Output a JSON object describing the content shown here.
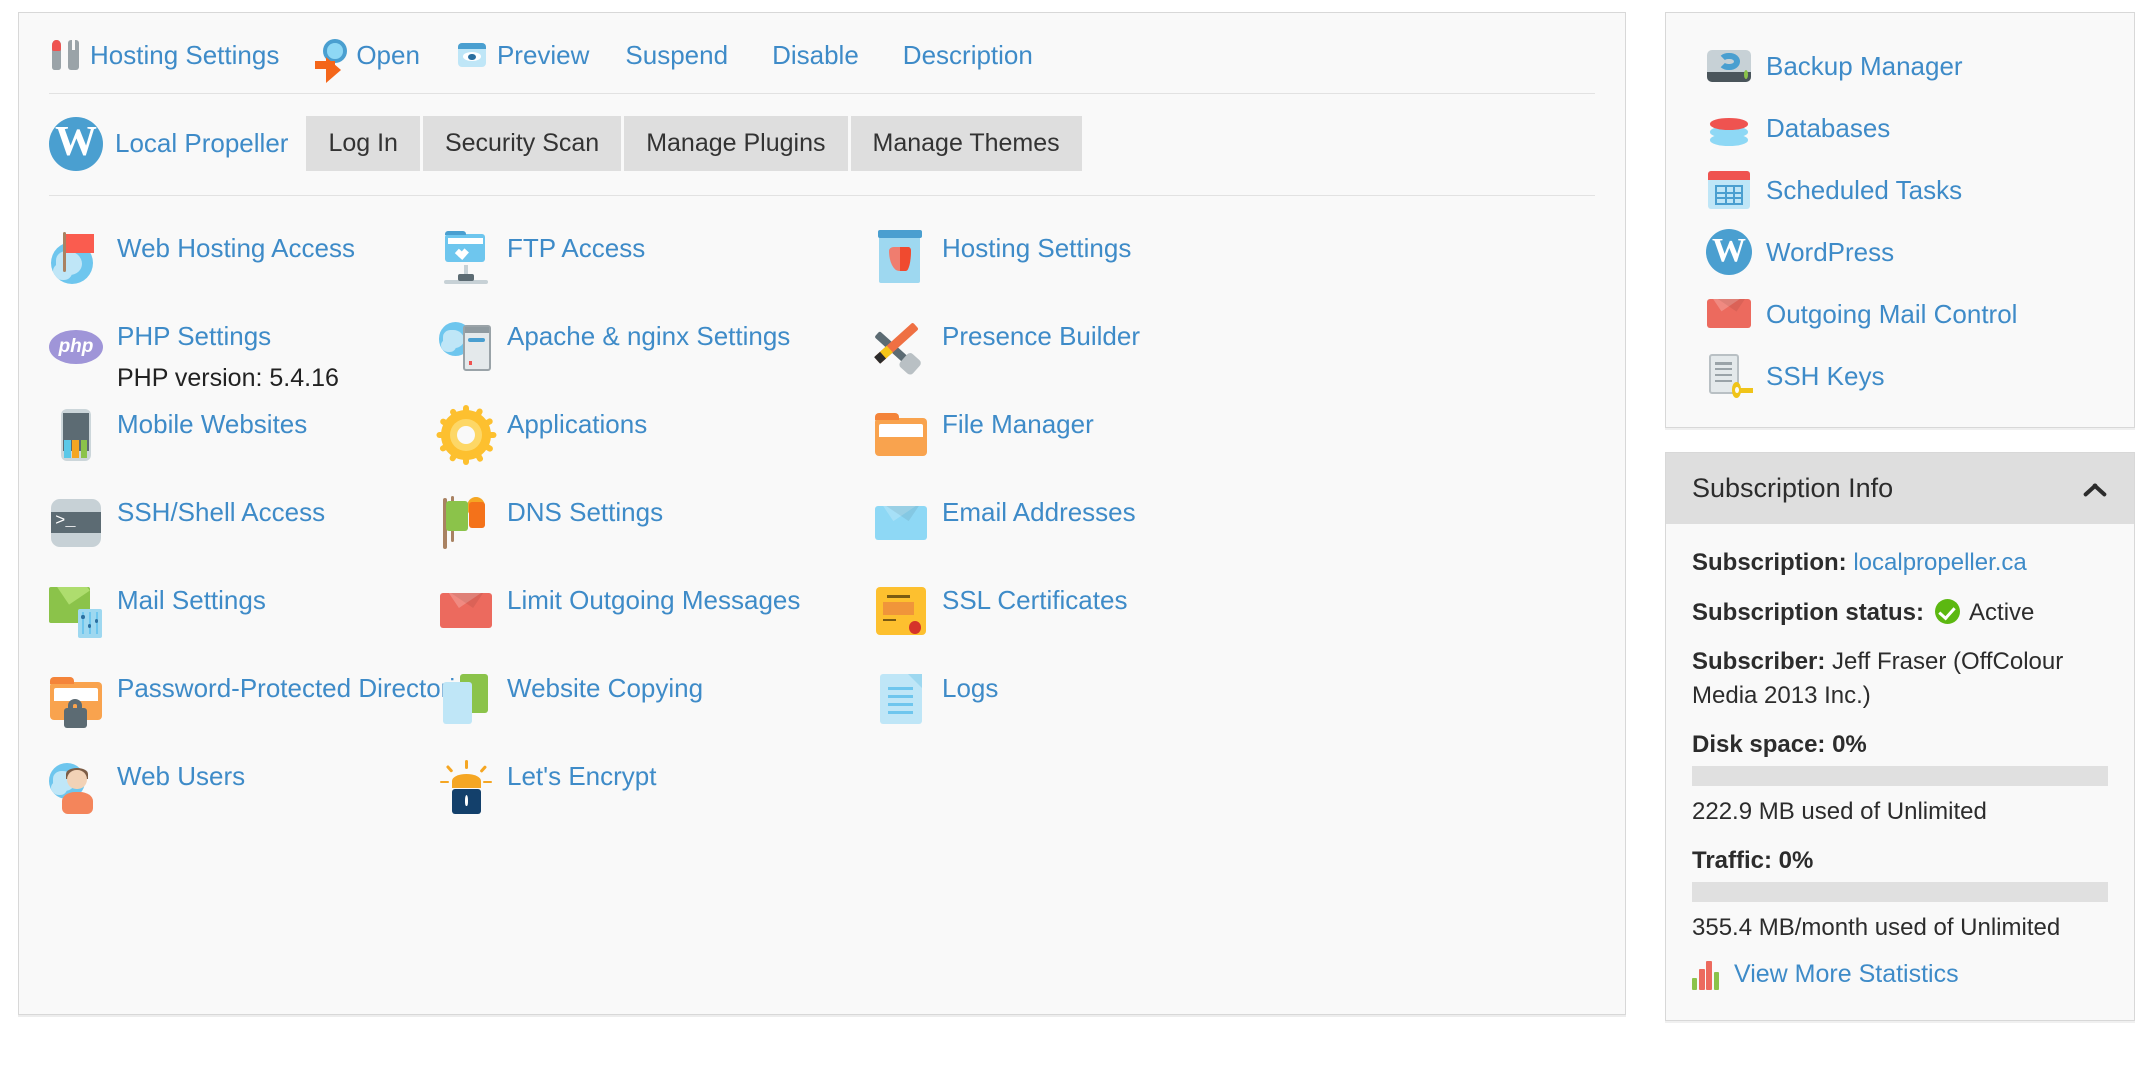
{
  "toolbar": {
    "items": [
      {
        "label": "Hosting Settings",
        "icon": "tools-icon",
        "has_icon": true
      },
      {
        "label": "Open",
        "icon": "open-globe-arrow-icon",
        "has_icon": true
      },
      {
        "label": "Preview",
        "icon": "preview-eye-icon",
        "has_icon": true
      },
      {
        "label": "Suspend",
        "icon": "",
        "has_icon": false
      },
      {
        "label": "Disable",
        "icon": "",
        "has_icon": false
      },
      {
        "label": "Description",
        "icon": "",
        "has_icon": false
      }
    ]
  },
  "wordpress_row": {
    "site_name": "Local Propeller",
    "icon": "wordpress-icon",
    "buttons": [
      "Log In",
      "Security Scan",
      "Manage Plugins",
      "Manage Themes"
    ]
  },
  "tools_grid": [
    {
      "label": "Web Hosting Access",
      "icon": "globe-flag-icon",
      "sub": ""
    },
    {
      "label": "FTP Access",
      "icon": "ftp-folder-icon",
      "sub": ""
    },
    {
      "label": "Hosting Settings",
      "icon": "shield-document-icon",
      "sub": ""
    },
    {
      "label": "PHP Settings",
      "icon": "php-icon",
      "sub": "PHP version: 5.4.16"
    },
    {
      "label": "Apache & nginx Settings",
      "icon": "server-globe-icon",
      "sub": ""
    },
    {
      "label": "Presence Builder",
      "icon": "hammer-pencil-icon",
      "sub": ""
    },
    {
      "label": "Mobile Websites",
      "icon": "mobile-phone-icon",
      "sub": ""
    },
    {
      "label": "Applications",
      "icon": "gear-icon",
      "sub": ""
    },
    {
      "label": "File Manager",
      "icon": "folder-icon",
      "sub": ""
    },
    {
      "label": "SSH/Shell Access",
      "icon": "terminal-icon",
      "sub": ""
    },
    {
      "label": "DNS Settings",
      "icon": "flags-icon",
      "sub": ""
    },
    {
      "label": "Email Addresses",
      "icon": "envelope-blue-icon",
      "sub": ""
    },
    {
      "label": "Mail Settings",
      "icon": "mail-settings-icon",
      "sub": ""
    },
    {
      "label": "Limit Outgoing Messages",
      "icon": "envelope-red-icon",
      "sub": ""
    },
    {
      "label": "SSL Certificates",
      "icon": "certificate-icon",
      "sub": ""
    },
    {
      "label": "Password-Protected Directories",
      "icon": "folder-lock-icon",
      "sub": ""
    },
    {
      "label": "Website Copying",
      "icon": "copy-pages-icon",
      "sub": ""
    },
    {
      "label": "Logs",
      "icon": "document-list-icon",
      "sub": ""
    },
    {
      "label": "Web Users",
      "icon": "user-globe-icon",
      "sub": ""
    },
    {
      "label": "Let's Encrypt",
      "icon": "lets-encrypt-lock-icon",
      "sub": ""
    },
    {
      "label": "",
      "icon": "",
      "sub": ""
    }
  ],
  "sidebar": {
    "links": [
      {
        "label": "Backup Manager",
        "icon": "backup-hdd-icon"
      },
      {
        "label": "Databases",
        "icon": "database-icon"
      },
      {
        "label": "Scheduled Tasks",
        "icon": "calendar-icon"
      },
      {
        "label": "WordPress",
        "icon": "wordpress-icon"
      },
      {
        "label": "Outgoing Mail Control",
        "icon": "envelope-red-icon"
      },
      {
        "label": "SSH Keys",
        "icon": "ssh-key-icon"
      }
    ]
  },
  "subscription_info": {
    "title": "Subscription Info",
    "collapse_icon": "chevron-up-icon",
    "subscription_label": "Subscription:",
    "subscription_value": "localpropeller.ca",
    "status_label": "Subscription status:",
    "status_value": "Active",
    "status_icon": "check-circle-icon",
    "subscriber_label": "Subscriber:",
    "subscriber_value": "Jeff Fraser (OffColour Media 2013 Inc.)",
    "disk_label": "Disk space: 0%",
    "disk_percent": 0,
    "disk_usage": "222.9 MB used of Unlimited",
    "traffic_label": "Traffic: 0%",
    "traffic_percent": 0,
    "traffic_usage": "355.4 MB/month used of Unlimited",
    "stats_link": "View More Statistics",
    "stats_icon": "bar-chart-icon"
  },
  "colors": {
    "link": "#3e8bc8",
    "panel_bg": "#f9f9f9",
    "button_bg": "#dedede",
    "border": "#d8d8d8",
    "status_green": "#5cb811"
  }
}
